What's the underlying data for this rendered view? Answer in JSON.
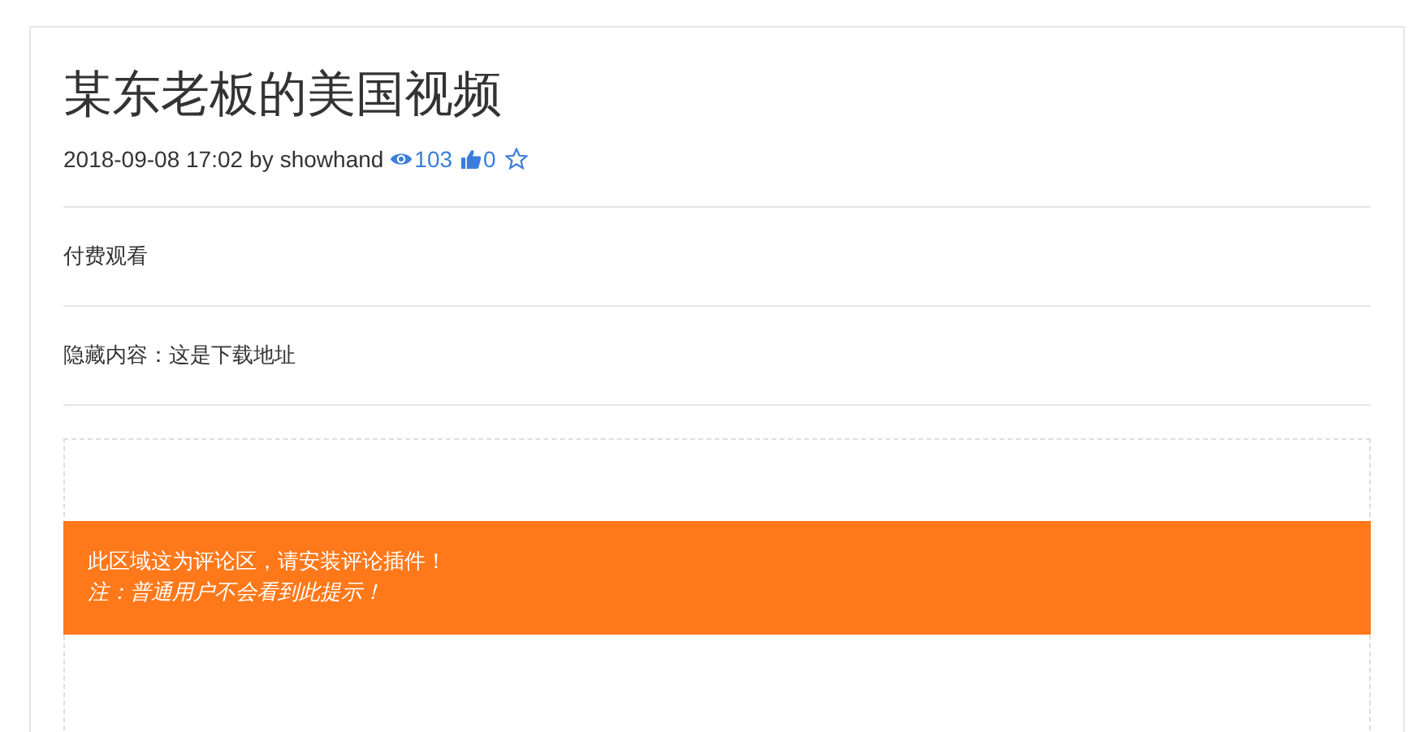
{
  "post": {
    "title": "某东老板的美国视频",
    "date": "2018-09-08 17:02",
    "by": "by",
    "author": "showhand",
    "views": "103",
    "likes": "0",
    "favorited": false
  },
  "sections": [
    {
      "text": "付费观看"
    },
    {
      "text": "隐藏内容：这是下载地址"
    }
  ],
  "comment_notice": {
    "lines": [
      {
        "text": "此区域这为评论区，请安装评论插件！",
        "kind": "plain"
      },
      {
        "text": "注：普通用户不会看到此提示！",
        "kind": "italic"
      }
    ]
  }
}
